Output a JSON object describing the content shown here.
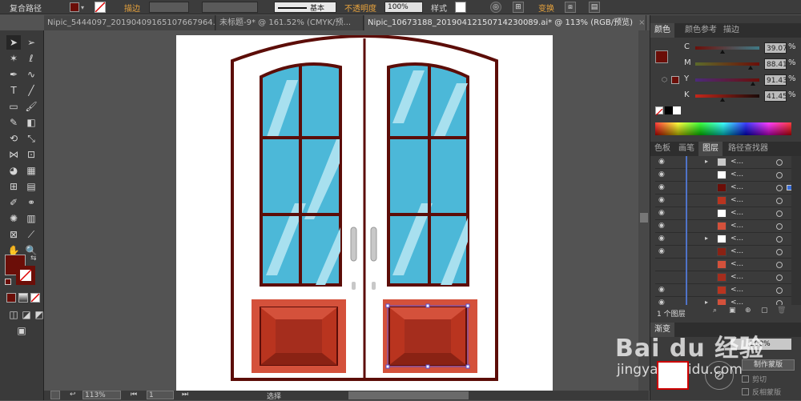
{
  "control_bar": {
    "path_type": "复合路径",
    "stroke_label": "描边",
    "stroke_style": "基本",
    "opacity_label": "不透明度",
    "opacity_value": "100%",
    "style_label": "样式",
    "transform_label": "变换"
  },
  "tabs": [
    {
      "label": "Nipic_5444097_20190409165107667964.ai*",
      "active": false
    },
    {
      "label": "未标题-9* @ 161.52% (CMYK/预...",
      "active": false
    },
    {
      "label": "Nipic_10673188_20190412150714230089.ai* @ 113% (RGB/预览)",
      "active": true
    }
  ],
  "color_panel": {
    "tabs": [
      "颜色",
      "颜色参考",
      "描边"
    ],
    "fill_color": "#6b0e08",
    "channels": [
      {
        "label": "C",
        "value": "39.07",
        "pct": 0.42,
        "gradient": "linear-gradient(to right,#6b0e08,#3f7a86)"
      },
      {
        "label": "M",
        "value": "88.41",
        "pct": 0.86,
        "gradient": "linear-gradient(to right,#5c6a2a,#6b0e08)"
      },
      {
        "label": "Y",
        "value": "91.43",
        "pct": 0.9,
        "gradient": "linear-gradient(to right,#4b2a7a,#6b0e08)"
      },
      {
        "label": "K",
        "value": "41.45",
        "pct": 0.42,
        "gradient": "linear-gradient(to right,#c4271b,#1a0a08)"
      }
    ]
  },
  "layers_panel": {
    "tabs": [
      "色板",
      "画笔",
      "图层",
      "路径查找器"
    ],
    "row_label": "<...",
    "layer_count": "1 个图层"
  },
  "transparency_panel": {
    "title": "渐变",
    "opacity": "100%",
    "make_mask_button": "制作蒙版",
    "clip_label": "剪切",
    "invert_label": "反相蒙版"
  },
  "status_bar": {
    "zoom": "113%",
    "page": "1",
    "tool": "选择"
  },
  "watermark": {
    "brand": "Bai du 经验",
    "url": "jingyan.baidu.com"
  },
  "colors": {
    "door_outline": "#5c0d08",
    "glass": "#4cb8d8",
    "glass_highlight": "#a8e0ef",
    "panel_outer": "#d4513b",
    "panel_inner": "#a52d1d",
    "panel_deep": "#8a2214"
  }
}
